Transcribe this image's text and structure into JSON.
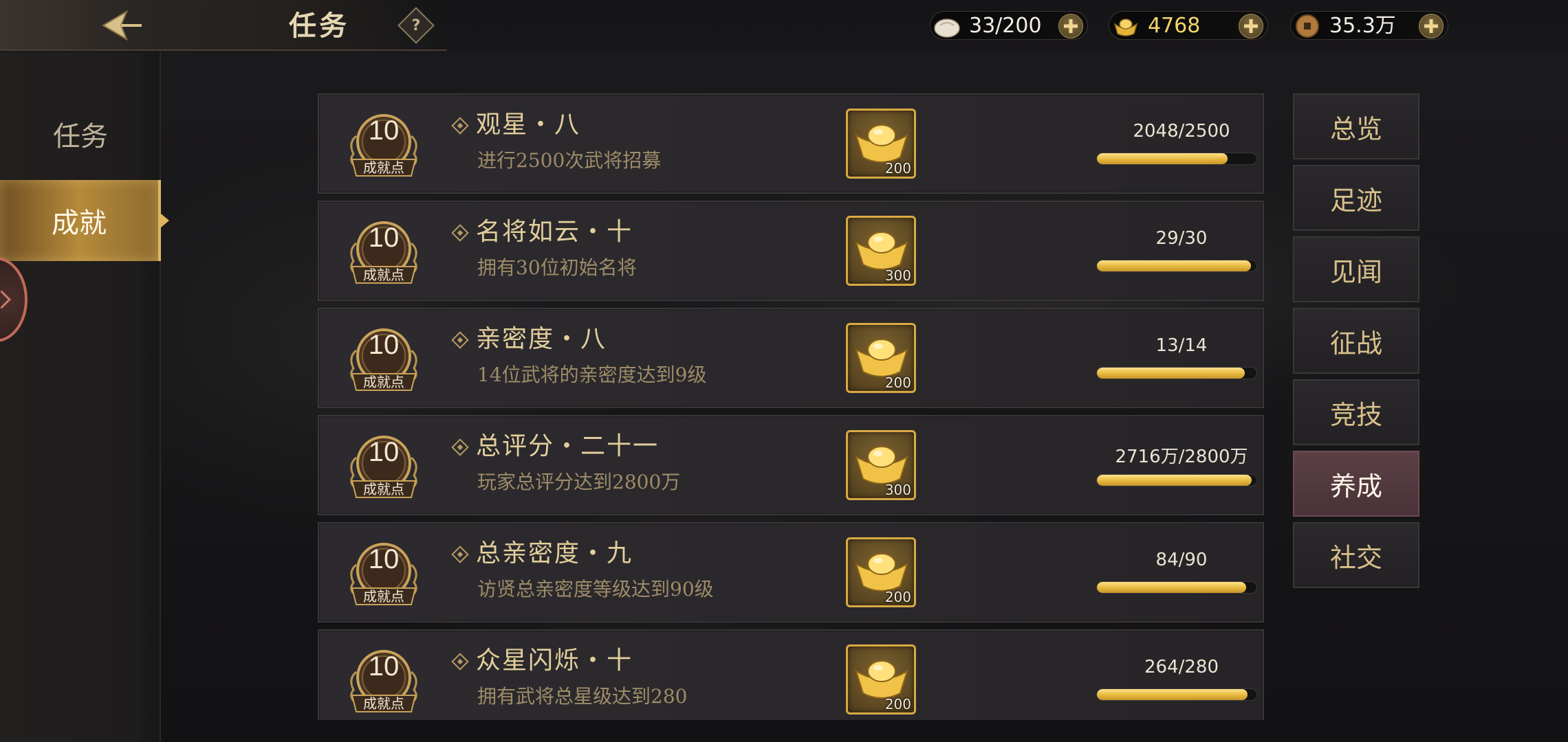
{
  "header": {
    "title": "任务",
    "help_label": "?"
  },
  "resources": [
    {
      "icon": "steamed-bun-icon",
      "value": "33/200"
    },
    {
      "icon": "gold-ingot-icon",
      "value": "4768"
    },
    {
      "icon": "copper-coin-icon",
      "value": "35.3万"
    }
  ],
  "leftnav": {
    "items": [
      {
        "label": "任务",
        "active": false
      },
      {
        "label": "成就",
        "active": true
      }
    ]
  },
  "achievements": [
    {
      "points": "10",
      "points_label": "成就点",
      "title": "观星・八",
      "desc": "进行2500次武将招募",
      "reward_qty": "200",
      "progress_text": "2048/2500",
      "progress": 0.8192
    },
    {
      "points": "10",
      "points_label": "成就点",
      "title": "名将如云・十",
      "desc": "拥有30位初始名将",
      "reward_qty": "300",
      "progress_text": "29/30",
      "progress": 0.9667
    },
    {
      "points": "10",
      "points_label": "成就点",
      "title": "亲密度・八",
      "desc": "14位武将的亲密度达到9级",
      "reward_qty": "200",
      "progress_text": "13/14",
      "progress": 0.9286
    },
    {
      "points": "10",
      "points_label": "成就点",
      "title": "总评分・二十一",
      "desc": "玩家总评分达到2800万",
      "reward_qty": "300",
      "progress_text": "2716万/2800万",
      "progress": 0.97
    },
    {
      "points": "10",
      "points_label": "成就点",
      "title": "总亲密度・九",
      "desc": "访贤总亲密度等级达到90级",
      "reward_qty": "200",
      "progress_text": "84/90",
      "progress": 0.9333
    },
    {
      "points": "10",
      "points_label": "成就点",
      "title": "众星闪烁・十",
      "desc": "拥有武将总星级达到280",
      "reward_qty": "200",
      "progress_text": "264/280",
      "progress": 0.9429
    }
  ],
  "categories": [
    {
      "label": "总览",
      "active": false
    },
    {
      "label": "足迹",
      "active": false
    },
    {
      "label": "见闻",
      "active": false
    },
    {
      "label": "征战",
      "active": false
    },
    {
      "label": "竞技",
      "active": false
    },
    {
      "label": "养成",
      "active": true
    },
    {
      "label": "社交",
      "active": false
    }
  ],
  "colors": {
    "accent_gold": "#e6b83e",
    "active_category": "#5a4045",
    "active_nav": "#b68a3a"
  }
}
